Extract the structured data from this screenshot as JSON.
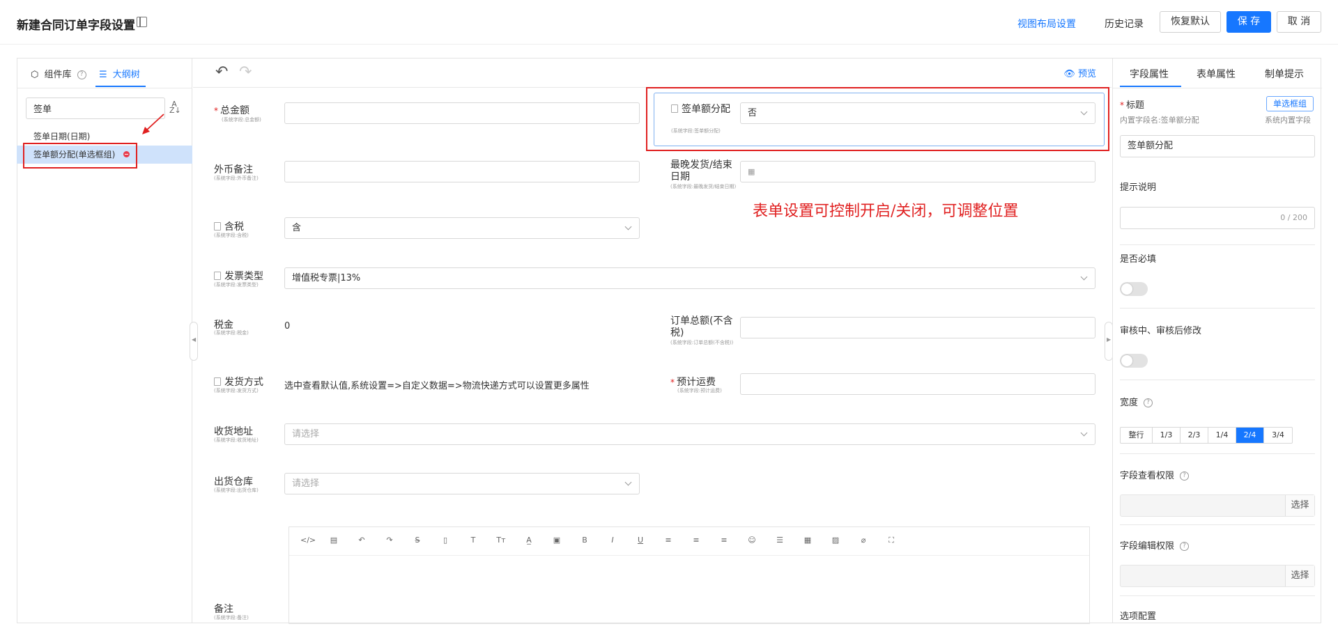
{
  "header": {
    "title": "新建合同订单字段设置",
    "view_layout": "视图布局设置",
    "history": "历史记录",
    "restore": "恢复默认",
    "save": "保 存",
    "cancel": "取 消"
  },
  "left_panel": {
    "tab_components": "组件库",
    "tab_outline": "大纲树",
    "search_value": "签单",
    "items": [
      {
        "label": "签单日期(日期)"
      },
      {
        "label": "签单额分配(单选框组)"
      }
    ]
  },
  "toolbar": {
    "preview": "预览"
  },
  "form": {
    "total": {
      "label": "总金额",
      "sub": "(系统字段:总金额)"
    },
    "sign_alloc": {
      "label": "签单额分配",
      "sub": "(系统字段:签单额分配)",
      "value": "否"
    },
    "fx_note": {
      "label": "外币备注",
      "sub": "(系统字段:外币备注)"
    },
    "latest_ship": {
      "label": "最晚发货/结束日期",
      "sub": "(系统字段:最晚发货/结束日期)"
    },
    "tax_incl": {
      "label": "含税",
      "sub": "(系统字段:含税)",
      "value": "含"
    },
    "invoice_type": {
      "label": "发票类型",
      "sub": "(系统字段:发票类型)",
      "value": "增值税专票|13%"
    },
    "tax": {
      "label": "税金",
      "sub": "(系统字段:税金)",
      "value": "0"
    },
    "order_total": {
      "label": "订单总额(不含税)",
      "sub": "(系统字段:订单总额(不含税))"
    },
    "ship_method": {
      "label": "发货方式",
      "sub": "(系统字段:发货方式)",
      "value": "选中查看默认值,系统设置=>自定义数据=>物流快递方式可以设置更多属性"
    },
    "freight": {
      "label": "预计运费",
      "sub": "(系统字段:预计运费)"
    },
    "address": {
      "label": "收货地址",
      "sub": "(系统字段:收货地址)",
      "placeholder": "请选择"
    },
    "warehouse": {
      "label": "出货仓库",
      "sub": "(系统字段:出货仓库)",
      "placeholder": "请选择"
    },
    "remark": {
      "label": "备注",
      "sub": "(系统字段:备注)"
    }
  },
  "annotation": "表单设置可控制开启/关闭，可调整位置",
  "editor_tools": [
    "code-icon",
    "template-icon",
    "undo-icon",
    "redo-icon",
    "strikethrough-icon",
    "document-icon",
    "text-icon",
    "font-size-icon",
    "font-color-icon",
    "background-color-icon",
    "bold-icon",
    "italic-icon",
    "underline-icon",
    "align-left-icon",
    "align-center-icon",
    "align-right-icon",
    "emoji-icon",
    "list-icon",
    "table-icon",
    "image-icon",
    "attachment-icon",
    "fullscreen-icon"
  ],
  "right_panel": {
    "tab_field": "字段属性",
    "tab_form": "表单属性",
    "tab_hint": "制单提示",
    "title_label": "标题",
    "title_type_badge": "单选框组",
    "builtin_name": "内置字段名:签单额分配",
    "system_builtin": "系统内置字段",
    "title_value": "签单额分配",
    "hint_label": "提示说明",
    "hint_counter": "0 / 200",
    "required_label": "是否必填",
    "edit_after_label": "审核中、审核后修改",
    "width_label": "宽度",
    "width_options": [
      "整行",
      "1/3",
      "2/3",
      "1/4",
      "2/4",
      "3/4"
    ],
    "width_selected": "2/4",
    "view_perm_label": "字段查看权限",
    "edit_perm_label": "字段编辑权限",
    "choose": "选择",
    "options_label": "选项配置"
  }
}
